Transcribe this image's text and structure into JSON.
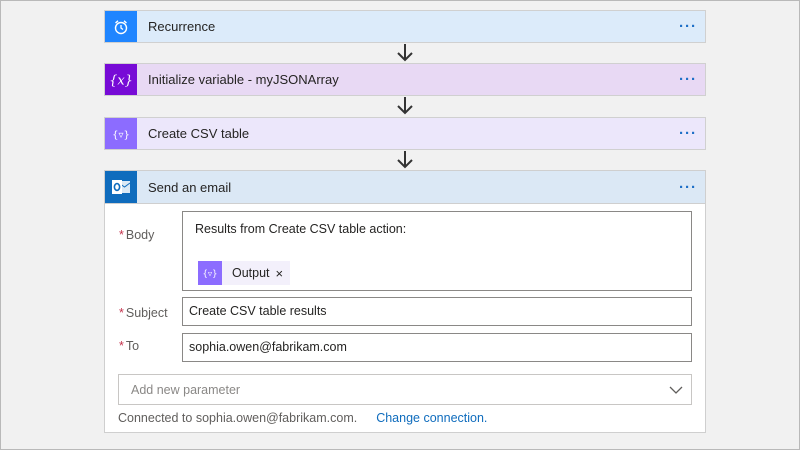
{
  "steps": [
    {
      "title": "Recurrence",
      "icon": "alarm-clock-icon",
      "color": "#1f85ff"
    },
    {
      "title": "Initialize variable - myJSONArray",
      "icon": "variable-icon",
      "color": "#770bd6"
    },
    {
      "title": "Create CSV table",
      "icon": "data-operation-icon",
      "color": "#8c6cff"
    }
  ],
  "more_label": "···",
  "email": {
    "title": "Send an email",
    "icon": "outlook-icon",
    "body": {
      "label": "Body",
      "required_marker": "*",
      "text": "Results from Create CSV table action:",
      "token_label": "Output",
      "token_remove": "×"
    },
    "subject": {
      "label": "Subject",
      "required_marker": "*",
      "value": "Create CSV table results"
    },
    "to": {
      "label": "To",
      "required_marker": "*",
      "value": "sophia.owen@fabrikam.com"
    },
    "add_parameter_placeholder": "Add new parameter",
    "connection_text": "Connected to sophia.owen@fabrikam.com.",
    "change_connection_label": "Change connection."
  }
}
